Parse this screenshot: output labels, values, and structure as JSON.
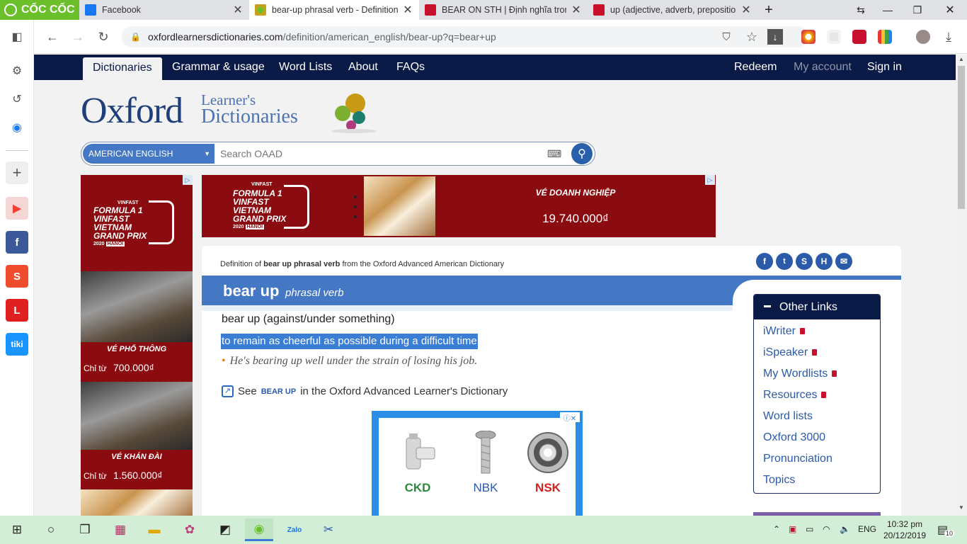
{
  "browser": {
    "brand": "CỐC CỐC",
    "tabs": [
      {
        "title": "Facebook",
        "favicon_color": "#1877f2",
        "active": false
      },
      {
        "title": "bear-up phrasal verb - Definition, p",
        "favicon_color": "#6bbf2a",
        "active": true
      },
      {
        "title": "BEAR ON STH | Định nghĩa trong T",
        "favicon_color": "#c8102e",
        "active": false
      },
      {
        "title": "up (adjective, adverb, preposition)",
        "favicon_color": "#c8102e",
        "active": false
      }
    ],
    "new_tab": "+",
    "url_domain": "oxfordlearnersdictionaries.com",
    "url_path": "/definition/american_english/bear-up?q=bear+up"
  },
  "sidebar_apps": [
    {
      "name": "youtube-icon",
      "glyph": "▶",
      "color": "#f44336"
    },
    {
      "name": "facebook-icon",
      "glyph": "f",
      "color": "#3b5998"
    },
    {
      "name": "shopee-icon",
      "glyph": "S",
      "color": "#ee4d2d"
    },
    {
      "name": "lazada-icon",
      "glyph": "L",
      "color": "#e02020"
    },
    {
      "name": "tiki-icon",
      "glyph": "tiki",
      "color": "#1a94ff"
    }
  ],
  "site": {
    "nav": {
      "dictionaries": "Dictionaries",
      "grammar": "Grammar & usage",
      "word_lists": "Word Lists",
      "about": "About",
      "faqs": "FAQs",
      "redeem": "Redeem",
      "my_account": "My account",
      "sign_in": "Sign in"
    },
    "logo": {
      "oxford": "Oxford",
      "learners": "Learner's",
      "dictionaries": "Dictionaries"
    },
    "search": {
      "dialect": "AMERICAN ENGLISH",
      "placeholder": "Search OAAD"
    }
  },
  "ads": {
    "f1_lines": [
      "FORMULA 1",
      "VINFAST",
      "VIETNAM",
      "GRAND PRIX"
    ],
    "f1_year": "2020",
    "f1_city": "HANOI",
    "f1_brand": "VINFAST",
    "left_ticket1_title": "VÉ PHỔ THÔNG",
    "left_ticket1_prefix": "Chỉ từ",
    "left_ticket1_price": "700.000₫",
    "left_ticket2_title": "VÉ KHÁN ĐÀI",
    "left_ticket2_prefix": "Chỉ từ",
    "left_ticket2_price": "1.560.000₫",
    "top_title": "VÉ DOANH NGHIỆP",
    "top_price": "19.740.000₫",
    "products": [
      "CKD",
      "NBK",
      "NSK"
    ]
  },
  "entry": {
    "definition_of_prefix": "Definition of",
    "definition_of_word": "bear up phrasal verb",
    "definition_of_suffix": "from the Oxford Advanced American Dictionary",
    "headword": "bear up",
    "pos": "phrasal verb",
    "phrasal": "bear up (against/under something)",
    "sense": "to remain as cheerful as possible during a difficult time",
    "example": "He's bearing up well under the strain of losing his job.",
    "see_prefix": "See",
    "see_word": "bear up",
    "see_suffix": "in the Oxford Advanced Learner's Dictionary"
  },
  "other_links": {
    "title": "Other Links",
    "items": [
      {
        "label": "iWriter",
        "locked": true
      },
      {
        "label": "iSpeaker",
        "locked": true
      },
      {
        "label": "My Wordlists",
        "locked": true
      },
      {
        "label": "Resources",
        "locked": true
      },
      {
        "label": "Word lists",
        "locked": false
      },
      {
        "label": "Oxford 3000",
        "locked": false
      },
      {
        "label": "Pronunciation",
        "locked": false
      },
      {
        "label": "Topics",
        "locked": false
      }
    ]
  },
  "taskbar": {
    "lang": "ENG",
    "time": "10:32 pm",
    "date": "20/12/2019",
    "notif_count": "10"
  }
}
